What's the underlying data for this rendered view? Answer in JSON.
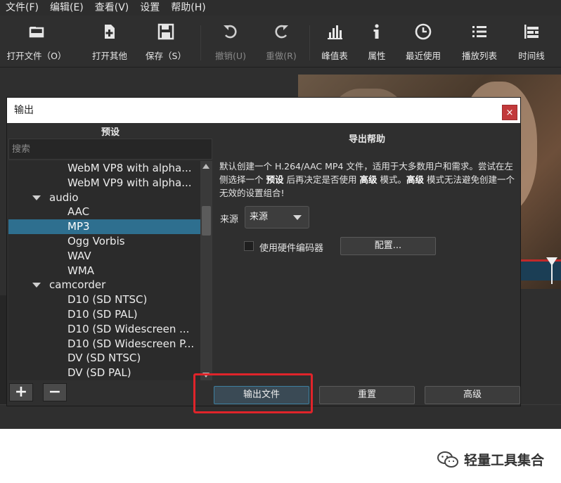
{
  "menubar": {
    "items": [
      "文件(F)",
      "编辑(E)",
      "查看(V)",
      "设置",
      "帮助(H)"
    ]
  },
  "toolbar": {
    "open_file": "打开文件（O）",
    "open_other": "打开其他",
    "save": "保存（S）",
    "undo": "撤销(U)",
    "redo": "重做(R)",
    "peak_meter": "峰值表",
    "properties": "属性",
    "recent": "最近使用",
    "playlist": "播放列表",
    "timeline": "时间线"
  },
  "dialog": {
    "title": "输出",
    "close_label": "×",
    "preset_header": "预设",
    "search_placeholder": "搜索",
    "tree": {
      "rows": [
        {
          "label": "WebM VP8 with alpha...",
          "type": "child"
        },
        {
          "label": "WebM VP9 with alpha...",
          "type": "child"
        },
        {
          "label": "audio",
          "type": "group"
        },
        {
          "label": "AAC",
          "type": "child"
        },
        {
          "label": "MP3",
          "type": "child",
          "selected": true
        },
        {
          "label": "Ogg Vorbis",
          "type": "child"
        },
        {
          "label": "WAV",
          "type": "child"
        },
        {
          "label": "WMA",
          "type": "child"
        },
        {
          "label": "camcorder",
          "type": "group"
        },
        {
          "label": "D10 (SD NTSC)",
          "type": "child"
        },
        {
          "label": "D10 (SD PAL)",
          "type": "child"
        },
        {
          "label": "D10 (SD Widescreen ...",
          "type": "child"
        },
        {
          "label": "D10 (SD Widescreen P...",
          "type": "child"
        },
        {
          "label": "DV (SD NTSC)",
          "type": "child"
        },
        {
          "label": "DV (SD PAL)",
          "type": "child"
        }
      ]
    },
    "add_button": "+",
    "remove_button": "−",
    "help_header": "导出帮助",
    "help_text": {
      "part1": "默认创建一个 H.264/AAC MP4 文件，适用于大多数用户和需求。尝试在左侧选择一个 ",
      "preset_word": "预设",
      "part2": " 后再决定是否使用 ",
      "advanced_word1": "高级",
      "part3": " 模式。",
      "advanced_word2": "高级",
      "part4": " 模式无法避免创建一个无效的设置组合!"
    },
    "source_label": "来源",
    "source_value": "来源",
    "hw_encoder_label": "使用硬件编码器",
    "hw_encoder_checked": false,
    "configure_button": "配置...",
    "export_button": "输出文件",
    "reset_button": "重置",
    "advanced_button": "高级"
  },
  "watermark": {
    "text": "轻量工具集合"
  },
  "colors": {
    "background": "#2f2f2f",
    "selection": "#2e6f8f",
    "close_button": "#c2393b",
    "highlight_box": "#e0242a"
  }
}
